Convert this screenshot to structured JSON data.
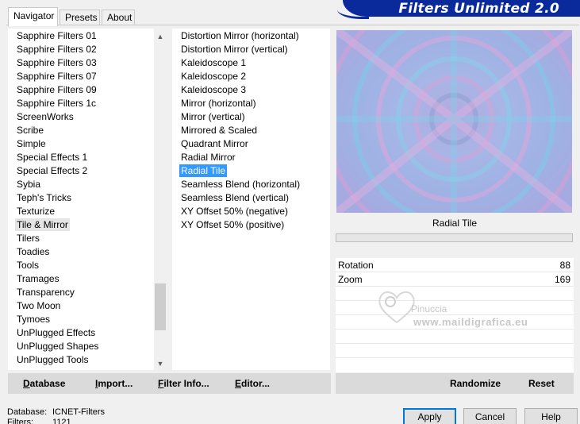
{
  "tabs": [
    {
      "label": "Navigator",
      "active": true
    },
    {
      "label": "Presets",
      "active": false
    },
    {
      "label": "About",
      "active": false
    }
  ],
  "banner": {
    "title": "Filters Unlimited 2.0",
    "color": "#0a2a9c"
  },
  "categories": {
    "items": [
      "Sapphire Filters 01",
      "Sapphire Filters 02",
      "Sapphire Filters 03",
      "Sapphire Filters 07",
      "Sapphire Filters 09",
      "Sapphire Filters 1c",
      "ScreenWorks",
      "Scribe",
      "Simple",
      "Special Effects 1",
      "Special Effects 2",
      "Sybia",
      "Teph's Tricks",
      "Texturize",
      "Tile & Mirror",
      "Tilers",
      "Toadies",
      "Tools",
      "Tramages",
      "Transparency",
      "Two Moon",
      "Tymoes",
      "UnPlugged Effects",
      "UnPlugged Shapes",
      "UnPlugged Tools"
    ],
    "selected": "Tile & Mirror"
  },
  "filters": {
    "items": [
      "Distortion Mirror (horizontal)",
      "Distortion Mirror (vertical)",
      "Kaleidoscope 1",
      "Kaleidoscope 2",
      "Kaleidoscope 3",
      "Mirror (horizontal)",
      "Mirror (vertical)",
      "Mirrored & Scaled",
      "Quadrant Mirror",
      "Radial Mirror",
      "Radial Tile",
      "Seamless Blend (horizontal)",
      "Seamless Blend (vertical)",
      "XY Offset 50% (negative)",
      "XY Offset 50% (positive)"
    ],
    "selected": "Radial Tile"
  },
  "preview": {
    "filter_name": "Radial Tile",
    "progress_percent": 0
  },
  "parameters": [
    {
      "label": "Rotation",
      "value": "88"
    },
    {
      "label": "Zoom",
      "value": "169"
    }
  ],
  "watermark": {
    "line1": "Pinuccia",
    "line2": "www.maildigrafica.eu"
  },
  "left_buttons": [
    {
      "label": "Database",
      "ul": "D"
    },
    {
      "label": "Import...",
      "ul": "I"
    },
    {
      "label": "Filter Info...",
      "ul": "F"
    },
    {
      "label": "Editor...",
      "ul": "E"
    }
  ],
  "right_buttons": [
    {
      "label": "Randomize"
    },
    {
      "label": "Reset"
    }
  ],
  "status": {
    "database_label": "Database:",
    "database_value": "ICNET-Filters",
    "filters_label": "Filters:",
    "filters_value": "1121"
  },
  "dialog_buttons": {
    "apply": "Apply",
    "cancel": "Cancel",
    "help": "Help"
  }
}
